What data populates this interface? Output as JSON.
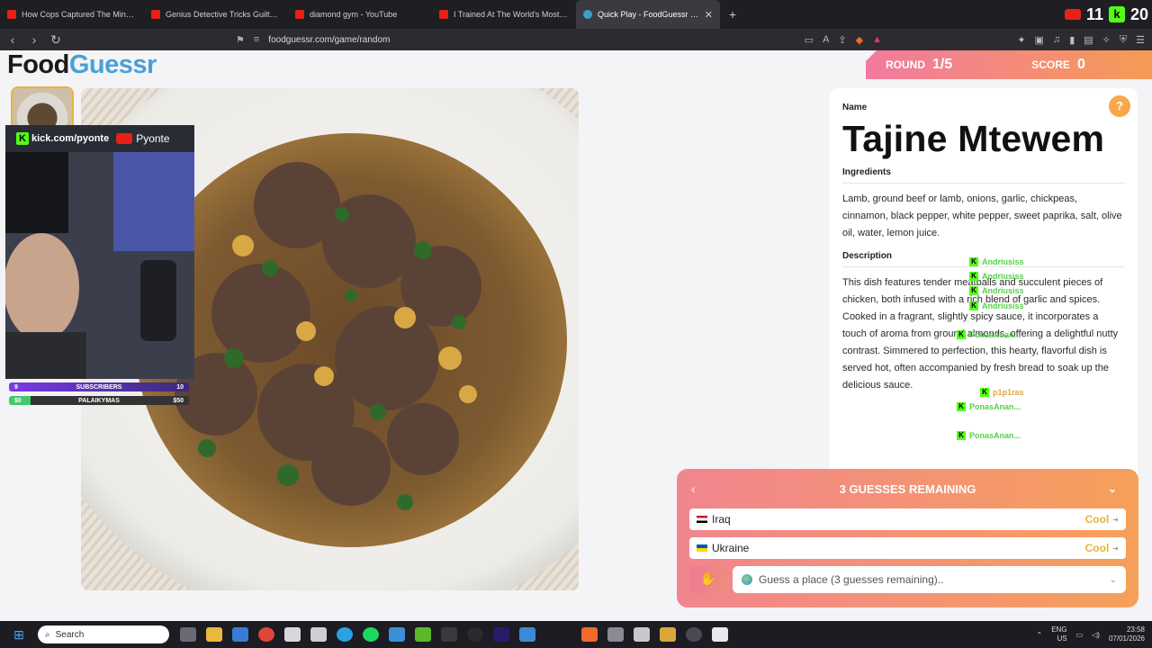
{
  "browser": {
    "tabs": [
      {
        "title": "How Cops Captured The Minnesota",
        "type": "youtube",
        "active": false
      },
      {
        "title": "Genius Detective Tricks Guilty Suspe",
        "type": "youtube",
        "active": false
      },
      {
        "title": "diamond gym - YouTube",
        "type": "youtube",
        "active": false
      },
      {
        "title": "I Trained At The World's Most Dange",
        "type": "youtube",
        "active": false
      },
      {
        "title": "Quick Play - FoodGuessr | Food",
        "type": "foodguessr",
        "active": true
      }
    ],
    "new_tab": "+",
    "close": "✕",
    "url": "foodguessr.com/game/random",
    "overlay_number_1": "11",
    "overlay_number_2": "20"
  },
  "logo": {
    "part1": "Food",
    "part2": "Guessr"
  },
  "stream": {
    "kick_handle": "kick.com/pyonte",
    "youtube_handle": "Pyonte",
    "subs_label": "SUBSCRIBERS",
    "subs_left": "9",
    "subs_right": "10",
    "goal_label": "PALAIKYMAS",
    "goal_left": "$0",
    "goal_right": "$50"
  },
  "round": {
    "label": "ROUND",
    "value": "1/5"
  },
  "score": {
    "label": "SCORE",
    "value": "0"
  },
  "dish": {
    "name_label": "Name",
    "name": "Tajine Mtewem",
    "ingredients_label": "Ingredients",
    "ingredients": "Lamb, ground beef or lamb, onions, garlic, chickpeas, cinnamon, black pepper, white pepper, sweet paprika, salt, olive oil, water, lemon juice.",
    "description_label": "Description",
    "description": "This dish features tender meatballs and succulent pieces of chicken, both infused with a rich blend of garlic and spices. Cooked in a fragrant, slightly spicy sauce, it incorporates a touch of aroma from ground almonds, offering a delightful nutty contrast. Simmered to perfection, this hearty, flavorful dish is served hot, often accompanied by fresh bread to soak up the delicious sauce."
  },
  "chat": [
    {
      "user": "Andriusiss",
      "color": "#53d04a"
    },
    {
      "user": "Andriusiss",
      "color": "#53d04a"
    },
    {
      "user": "Andriusiss",
      "color": "#53d04a"
    },
    {
      "user": "Andriusiss",
      "color": "#53d04a"
    },
    {
      "user": "PonasAnan...",
      "color": "#53d04a"
    },
    {
      "user": "p1p1ras",
      "color": "#e6a43a"
    },
    {
      "user": "PonasAnan...",
      "color": "#53d04a"
    },
    {
      "user": "PonasAnan...",
      "color": "#53d04a"
    }
  ],
  "guesses": {
    "remaining_title": "3 GUESSES REMAINING",
    "list": [
      {
        "country": "Iraq",
        "flag": "iq",
        "result": "Cool"
      },
      {
        "country": "Ukraine",
        "flag": "ua",
        "result": "Cool"
      }
    ],
    "placeholder": "Guess a place (3 guesses remaining).."
  },
  "taskbar": {
    "search_label": "Search",
    "lang": "ENG",
    "region": "US",
    "time": "23:58",
    "date": "07/01/2026"
  },
  "colors": {
    "accent_orange": "#f59b55",
    "accent_pink": "#f27aa0",
    "logo_blue": "#4aa0d8",
    "cool_yellow": "#e8b33a"
  }
}
